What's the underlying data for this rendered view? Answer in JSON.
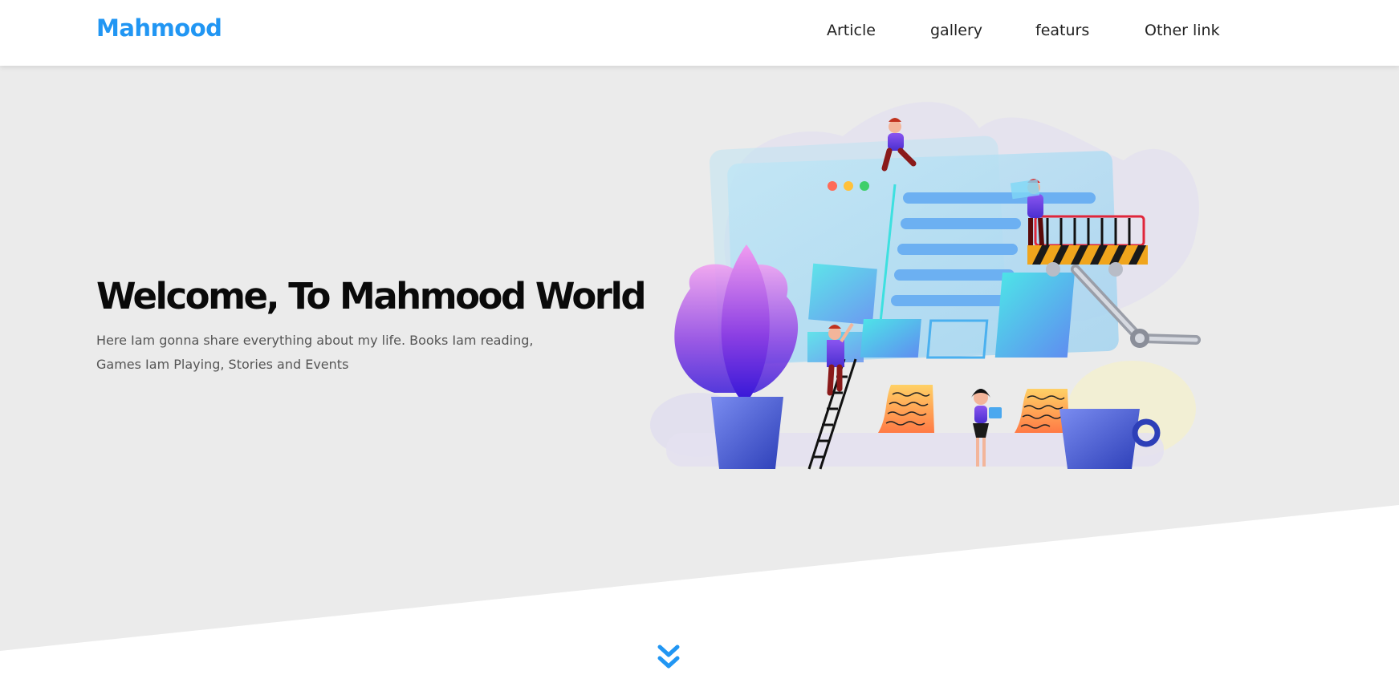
{
  "brand": {
    "name": "Mahmood",
    "color": "#2196f3"
  },
  "nav": {
    "items": [
      {
        "label": "Article"
      },
      {
        "label": "gallery"
      },
      {
        "label": "featurs"
      },
      {
        "label": "Other link"
      }
    ]
  },
  "hero": {
    "title": "Welcome, To Mahmood World",
    "description": "Here Iam gonna share everything about my life. Books Iam reading, Games Iam Playing, Stories and Events",
    "background": "#ebebeb"
  },
  "scroll_indicator": {
    "icon": "double-chevron-down-icon",
    "color": "#2196f3"
  }
}
